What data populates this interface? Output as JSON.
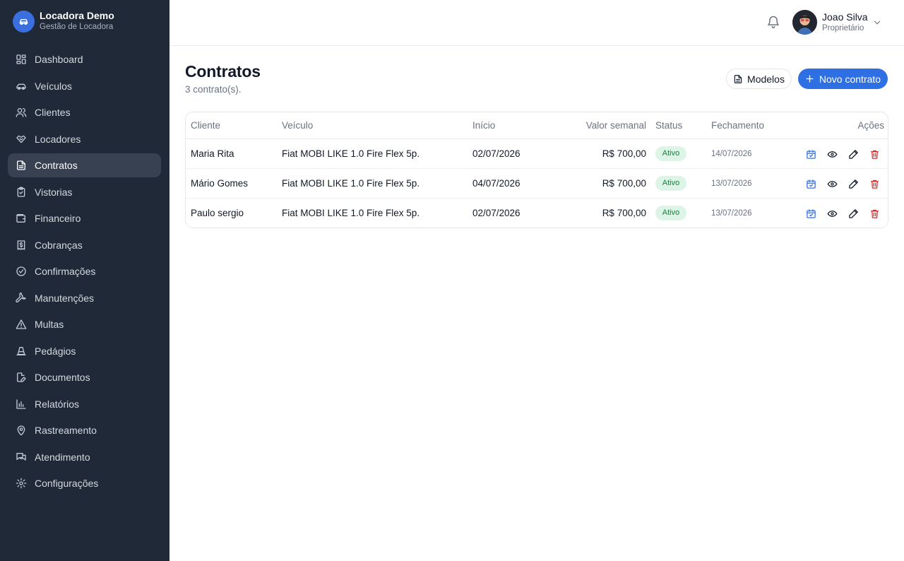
{
  "brand": {
    "name": "Locadora Demo",
    "subtitle": "Gestão de Locadora",
    "accent": "#3b6fe0"
  },
  "sidebar": {
    "items": [
      {
        "label": "Dashboard",
        "icon": "dashboard-icon"
      },
      {
        "label": "Veículos",
        "icon": "car-icon"
      },
      {
        "label": "Clientes",
        "icon": "users-icon"
      },
      {
        "label": "Locadores",
        "icon": "handshake-icon"
      },
      {
        "label": "Contratos",
        "icon": "file-text-icon",
        "active": true
      },
      {
        "label": "Vistorias",
        "icon": "clipboard-check-icon"
      },
      {
        "label": "Financeiro",
        "icon": "wallet-icon"
      },
      {
        "label": "Cobranças",
        "icon": "receipt-dollar-icon"
      },
      {
        "label": "Confirmações",
        "icon": "check-circle-icon"
      },
      {
        "label": "Manutenções",
        "icon": "wrench-icon"
      },
      {
        "label": "Multas",
        "icon": "alert-triangle-icon"
      },
      {
        "label": "Pedágios",
        "icon": "traffic-cone-icon"
      },
      {
        "label": "Documentos",
        "icon": "file-edit-icon"
      },
      {
        "label": "Relatórios",
        "icon": "bar-chart-icon"
      },
      {
        "label": "Rastreamento",
        "icon": "map-pin-icon"
      },
      {
        "label": "Atendimento",
        "icon": "messages-icon"
      },
      {
        "label": "Configurações",
        "icon": "gear-icon"
      }
    ]
  },
  "topbar": {
    "user_name": "Joao Silva",
    "user_role": "Proprietário"
  },
  "header": {
    "title": "Contratos",
    "count": "3 contrato(s).",
    "modelos_label": "Modelos",
    "novo_label": "Novo contrato",
    "primary_color": "#2f6fe4"
  },
  "table": {
    "columns": {
      "cliente": "Cliente",
      "veiculo": "Veículo",
      "inicio": "Início",
      "valor": "Valor semanal",
      "status": "Status",
      "fechamento": "Fechamento",
      "acoes": "Ações"
    },
    "rows": [
      {
        "cliente": "Maria Rita",
        "veiculo": "Fiat MOBI LIKE 1.0 Fire Flex 5p.",
        "inicio": "02/07/2026",
        "valor": "R$ 700,00",
        "status": "Ativo",
        "fechamento": "14/07/2026"
      },
      {
        "cliente": "Mário Gomes",
        "veiculo": "Fiat MOBI LIKE 1.0 Fire Flex 5p.",
        "inicio": "04/07/2026",
        "valor": "R$ 700,00",
        "status": "Ativo",
        "fechamento": "13/07/2026"
      },
      {
        "cliente": "Paulo sergio",
        "veiculo": "Fiat MOBI LIKE 1.0 Fire Flex 5p.",
        "inicio": "02/07/2026",
        "valor": "R$ 700,00",
        "status": "Ativo",
        "fechamento": "13/07/2026"
      }
    ]
  },
  "colors": {
    "sidebar_bg": "#1f2937",
    "status_bg": "#dcf5e6",
    "status_text": "#17803d",
    "delete": "#dc2626"
  }
}
